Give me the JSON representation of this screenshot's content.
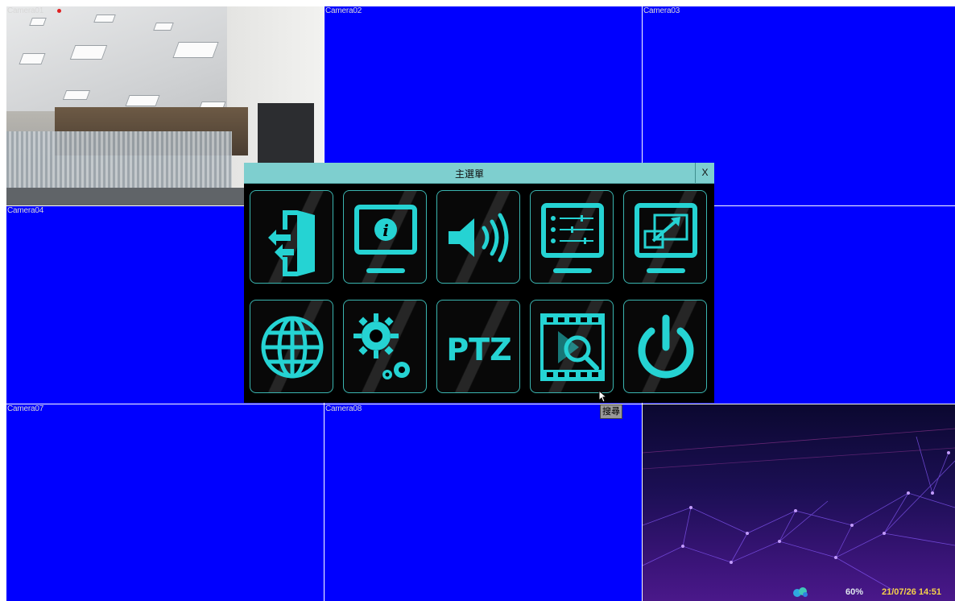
{
  "cameras": [
    {
      "label": "Camera01"
    },
    {
      "label": "Camera02"
    },
    {
      "label": "Camera03"
    },
    {
      "label": "Camera04"
    },
    {
      "label": "Camera07"
    },
    {
      "label": "Camera08"
    }
  ],
  "dialog": {
    "title": "主選單",
    "close_label": "X",
    "items": [
      {
        "icon": "logout-door-icon"
      },
      {
        "icon": "system-info-icon"
      },
      {
        "icon": "volume-icon"
      },
      {
        "icon": "settings-list-icon"
      },
      {
        "icon": "display-resize-icon"
      },
      {
        "icon": "network-globe-icon"
      },
      {
        "icon": "gears-icon"
      },
      {
        "icon": "ptz-icon",
        "text": "PTZ"
      },
      {
        "icon": "video-search-icon"
      },
      {
        "icon": "power-icon"
      }
    ]
  },
  "tooltip": "搜尋",
  "status_bar": {
    "percent": "60%",
    "datetime": "21/07/26 14:51"
  },
  "colors": {
    "camera_bg": "#0000ff",
    "accent": "#25d3d3",
    "titlebar": "#7ecfcf"
  }
}
